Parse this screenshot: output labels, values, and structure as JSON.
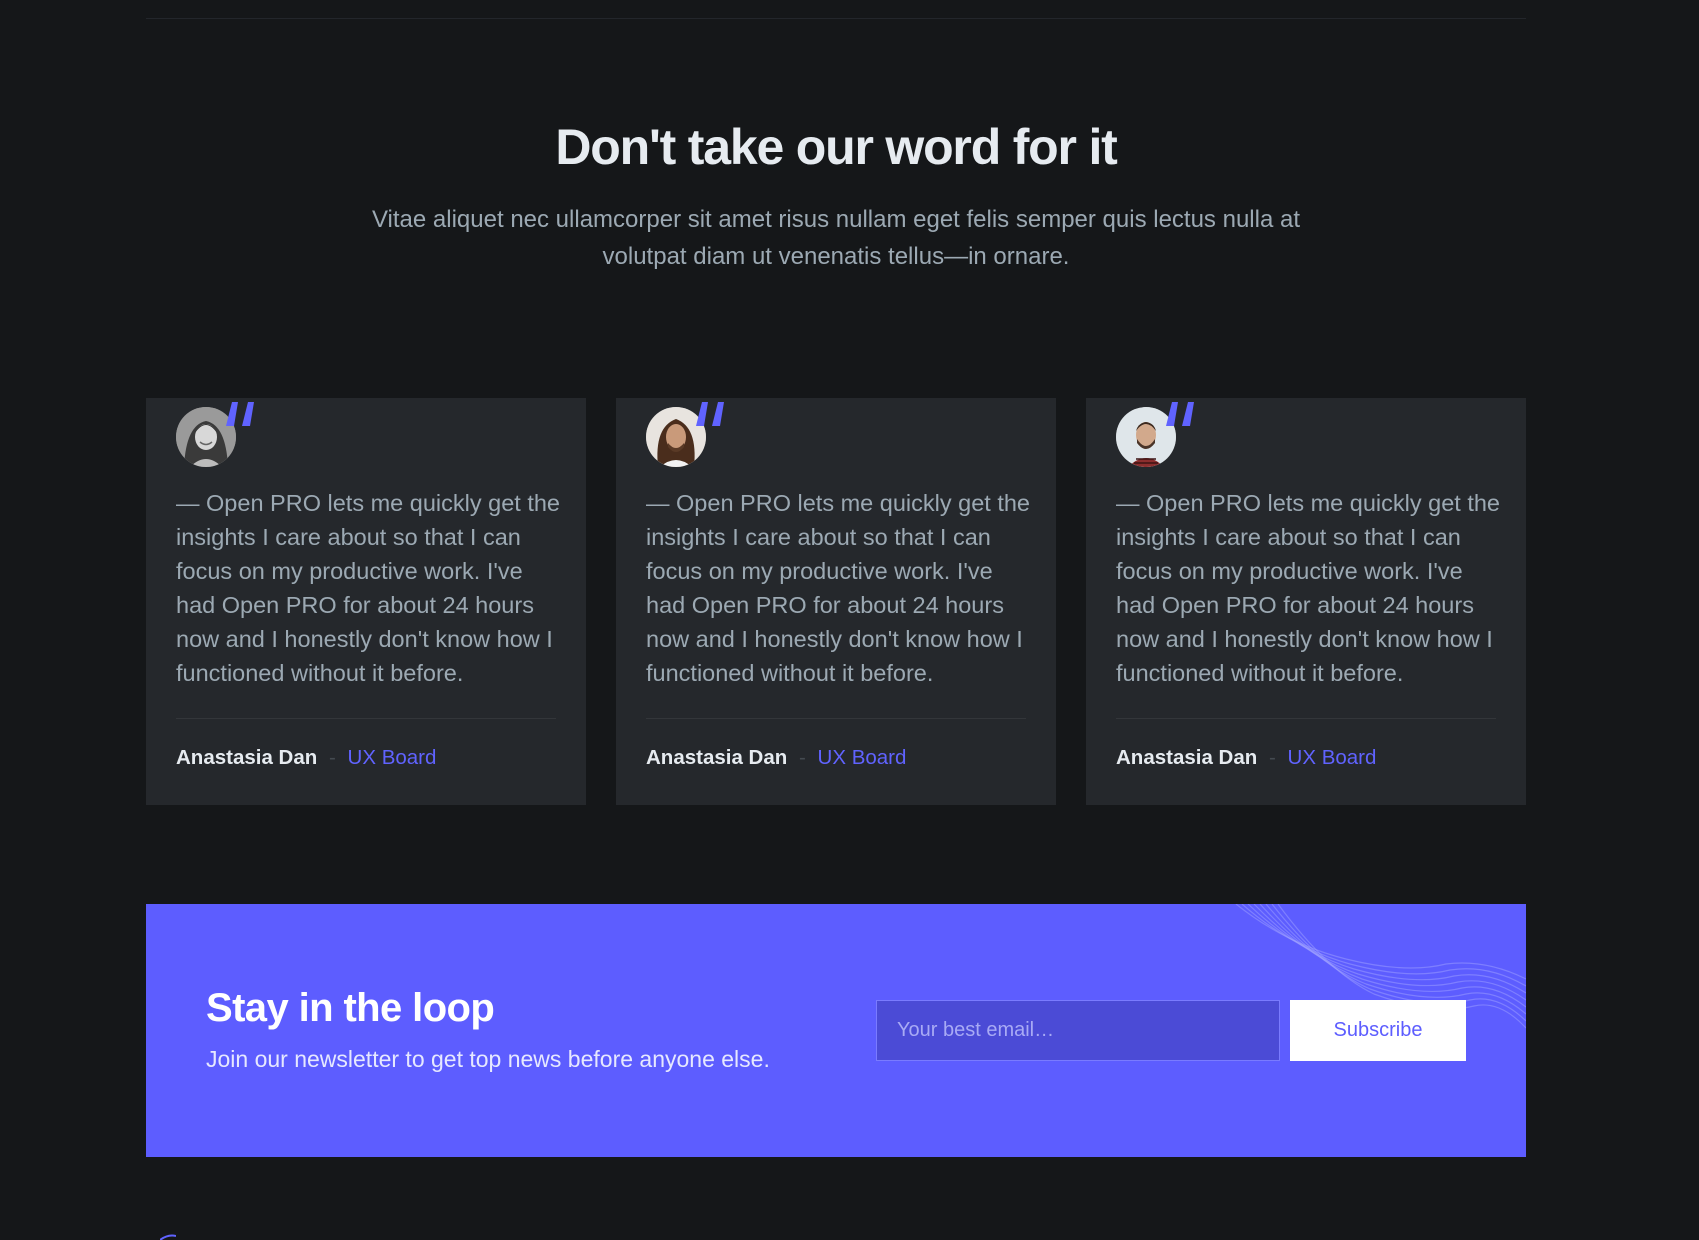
{
  "section": {
    "title": "Don't take our word for it",
    "subtitle": "Vitae aliquet nec ullamcorper sit amet risus nullam eget felis semper quis lectus nulla at volutpat diam ut venenatis tellus—in ornare."
  },
  "testimonials": [
    {
      "avatar_icon": "woman-avatar",
      "quote": "— Open PRO lets me quickly get the insights I care about so that I can focus on my productive work. I've had Open PRO for about 24 hours now and I honestly don't know how I functioned without it before.",
      "name": "Anastasia Dan",
      "separator": "-",
      "company": "UX Board"
    },
    {
      "avatar_icon": "man-long-hair-avatar",
      "quote": "— Open PRO lets me quickly get the insights I care about so that I can focus on my productive work. I've had Open PRO for about 24 hours now and I honestly don't know how I functioned without it before.",
      "name": "Anastasia Dan",
      "separator": "-",
      "company": "UX Board"
    },
    {
      "avatar_icon": "man-beard-avatar",
      "quote": "— Open PRO lets me quickly get the insights I care about so that I can focus on my productive work. I've had Open PRO for about 24 hours now and I honestly don't know how I functioned without it before.",
      "name": "Anastasia Dan",
      "separator": "-",
      "company": "UX Board"
    }
  ],
  "newsletter": {
    "title": "Stay in the loop",
    "subtitle": "Join our newsletter to get top news before anyone else.",
    "email_placeholder": "Your best email…",
    "subscribe_label": "Subscribe"
  },
  "colors": {
    "background": "#151719",
    "card": "#25282c",
    "accent": "#5d5dff",
    "heading": "#e6ebf0",
    "body_text": "#9ca9b3"
  }
}
